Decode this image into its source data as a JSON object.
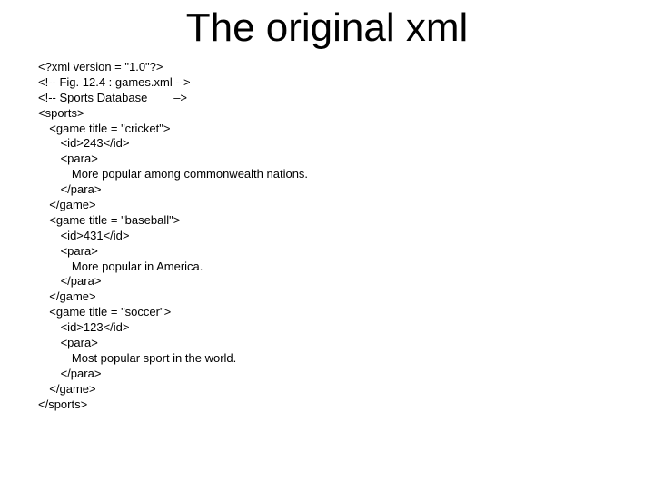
{
  "slide": {
    "title": "The original xml",
    "lines": [
      {
        "indent": 0,
        "text": "<?xml version = \"1.0\"?>"
      },
      {
        "indent": 0,
        "text": "<!-- Fig. 12.4 : games.xml -->"
      },
      {
        "indent": 0,
        "text": "<!-- Sports Database        –>"
      },
      {
        "indent": 0,
        "text": "<sports>"
      },
      {
        "indent": 1,
        "text": "<game title = \"cricket\">"
      },
      {
        "indent": 2,
        "text": "<id>243</id>"
      },
      {
        "indent": 2,
        "text": "<para>"
      },
      {
        "indent": 3,
        "text": "More popular among commonwealth nations."
      },
      {
        "indent": 2,
        "text": "</para>"
      },
      {
        "indent": 1,
        "text": "</game>"
      },
      {
        "indent": 1,
        "text": "<game title = \"baseball\">"
      },
      {
        "indent": 2,
        "text": "<id>431</id>"
      },
      {
        "indent": 2,
        "text": "<para>"
      },
      {
        "indent": 3,
        "text": "More popular in America."
      },
      {
        "indent": 2,
        "text": "</para>"
      },
      {
        "indent": 1,
        "text": "</game>"
      },
      {
        "indent": 1,
        "text": "<game title = \"soccer\">"
      },
      {
        "indent": 2,
        "text": "<id>123</id>"
      },
      {
        "indent": 2,
        "text": "<para>"
      },
      {
        "indent": 3,
        "text": "Most popular sport in the world."
      },
      {
        "indent": 2,
        "text": "</para>"
      },
      {
        "indent": 1,
        "text": "</game>"
      },
      {
        "indent": 0,
        "text": "</sports>"
      }
    ]
  }
}
